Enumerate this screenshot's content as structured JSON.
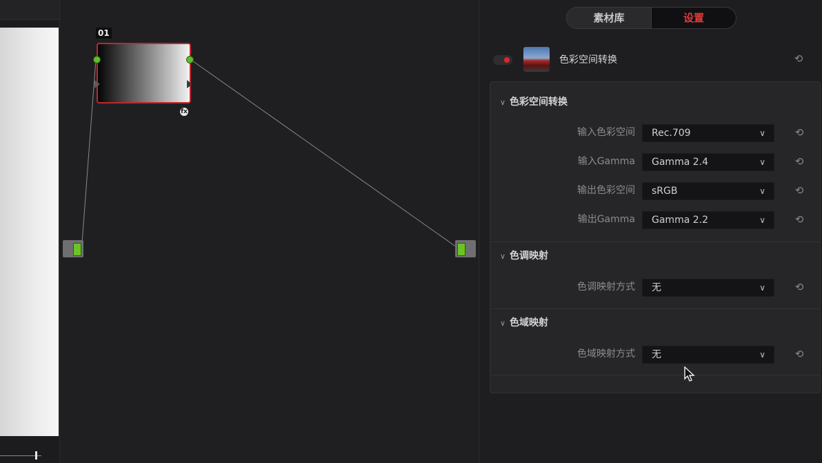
{
  "node_editor": {
    "node": {
      "label": "01",
      "fx_badge": "fx"
    }
  },
  "inspector": {
    "tabs": [
      {
        "label": "素材库",
        "active": false
      },
      {
        "label": "设置",
        "active": true
      }
    ],
    "effect": {
      "title": "色彩空间转换",
      "enabled": true
    },
    "sections": [
      {
        "title": "色彩空间转换",
        "rows": [
          {
            "label": "输入色彩空间",
            "value": "Rec.709"
          },
          {
            "label": "输入Gamma",
            "value": "Gamma 2.4"
          },
          {
            "label": "输出色彩空间",
            "value": "sRGB"
          },
          {
            "label": "输出Gamma",
            "value": "Gamma 2.2"
          }
        ]
      },
      {
        "title": "色调映射",
        "rows": [
          {
            "label": "色调映射方式",
            "value": "无"
          }
        ]
      },
      {
        "title": "色域映射",
        "rows": [
          {
            "label": "色域映射方式",
            "value": "无"
          }
        ]
      }
    ]
  },
  "colors": {
    "accent_red": "#e23a3a",
    "node_border": "#c2262b",
    "port_green": "#5fbf2a",
    "panel_bg": "#262629"
  }
}
